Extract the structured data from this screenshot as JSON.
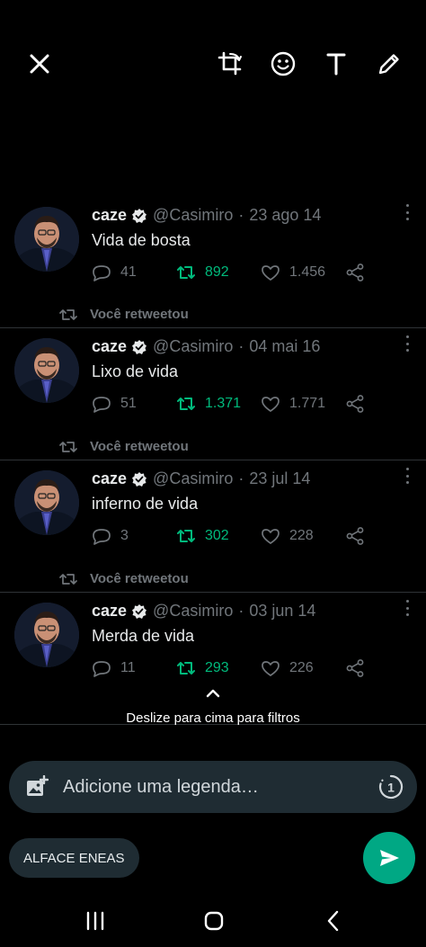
{
  "toolbar": {
    "close_icon": "close-icon",
    "crop_icon": "crop-rotate-icon",
    "sticker_icon": "emoji-icon",
    "text_icon": "text-icon",
    "draw_icon": "pencil-icon"
  },
  "tweets": [
    {
      "retweeted_label": "",
      "name": "caze",
      "handle": "@Casimiro",
      "separator": "·",
      "date": "23 ago 14",
      "text": "Vida de bosta",
      "replies": "41",
      "retweets": "892",
      "likes": "1.456"
    },
    {
      "retweeted_label": "Você retweetou",
      "name": "caze",
      "handle": "@Casimiro",
      "separator": "·",
      "date": "04 mai 16",
      "text": "Lixo de vida",
      "replies": "51",
      "retweets": "1.371",
      "likes": "1.771"
    },
    {
      "retweeted_label": "Você retweetou",
      "name": "caze",
      "handle": "@Casimiro",
      "separator": "·",
      "date": "23 jul 14",
      "text": "inferno de vida",
      "replies": "3",
      "retweets": "302",
      "likes": "228"
    },
    {
      "retweeted_label": "Você retweetou",
      "name": "caze",
      "handle": "@Casimiro",
      "separator": "·",
      "date": "03 jun 14",
      "text": "Merda de vida",
      "replies": "11",
      "retweets": "293",
      "likes": "226"
    }
  ],
  "filters_hint": "Deslize para cima para filtros",
  "caption": {
    "placeholder": "Adicione uma legenda…",
    "view_once_icon": "view-once-icon",
    "add_media_icon": "add-photo-icon"
  },
  "recipient_chip": "ALFACE ENEAS",
  "send_icon": "send-icon",
  "colors": {
    "background": "#000000",
    "retweet_green": "#00ba7c",
    "muted_gray": "#71767b",
    "send_green": "#00a884",
    "bar_bg": "#1f2c33"
  },
  "system_nav": [
    "recent-apps-icon",
    "home-icon",
    "back-icon"
  ]
}
